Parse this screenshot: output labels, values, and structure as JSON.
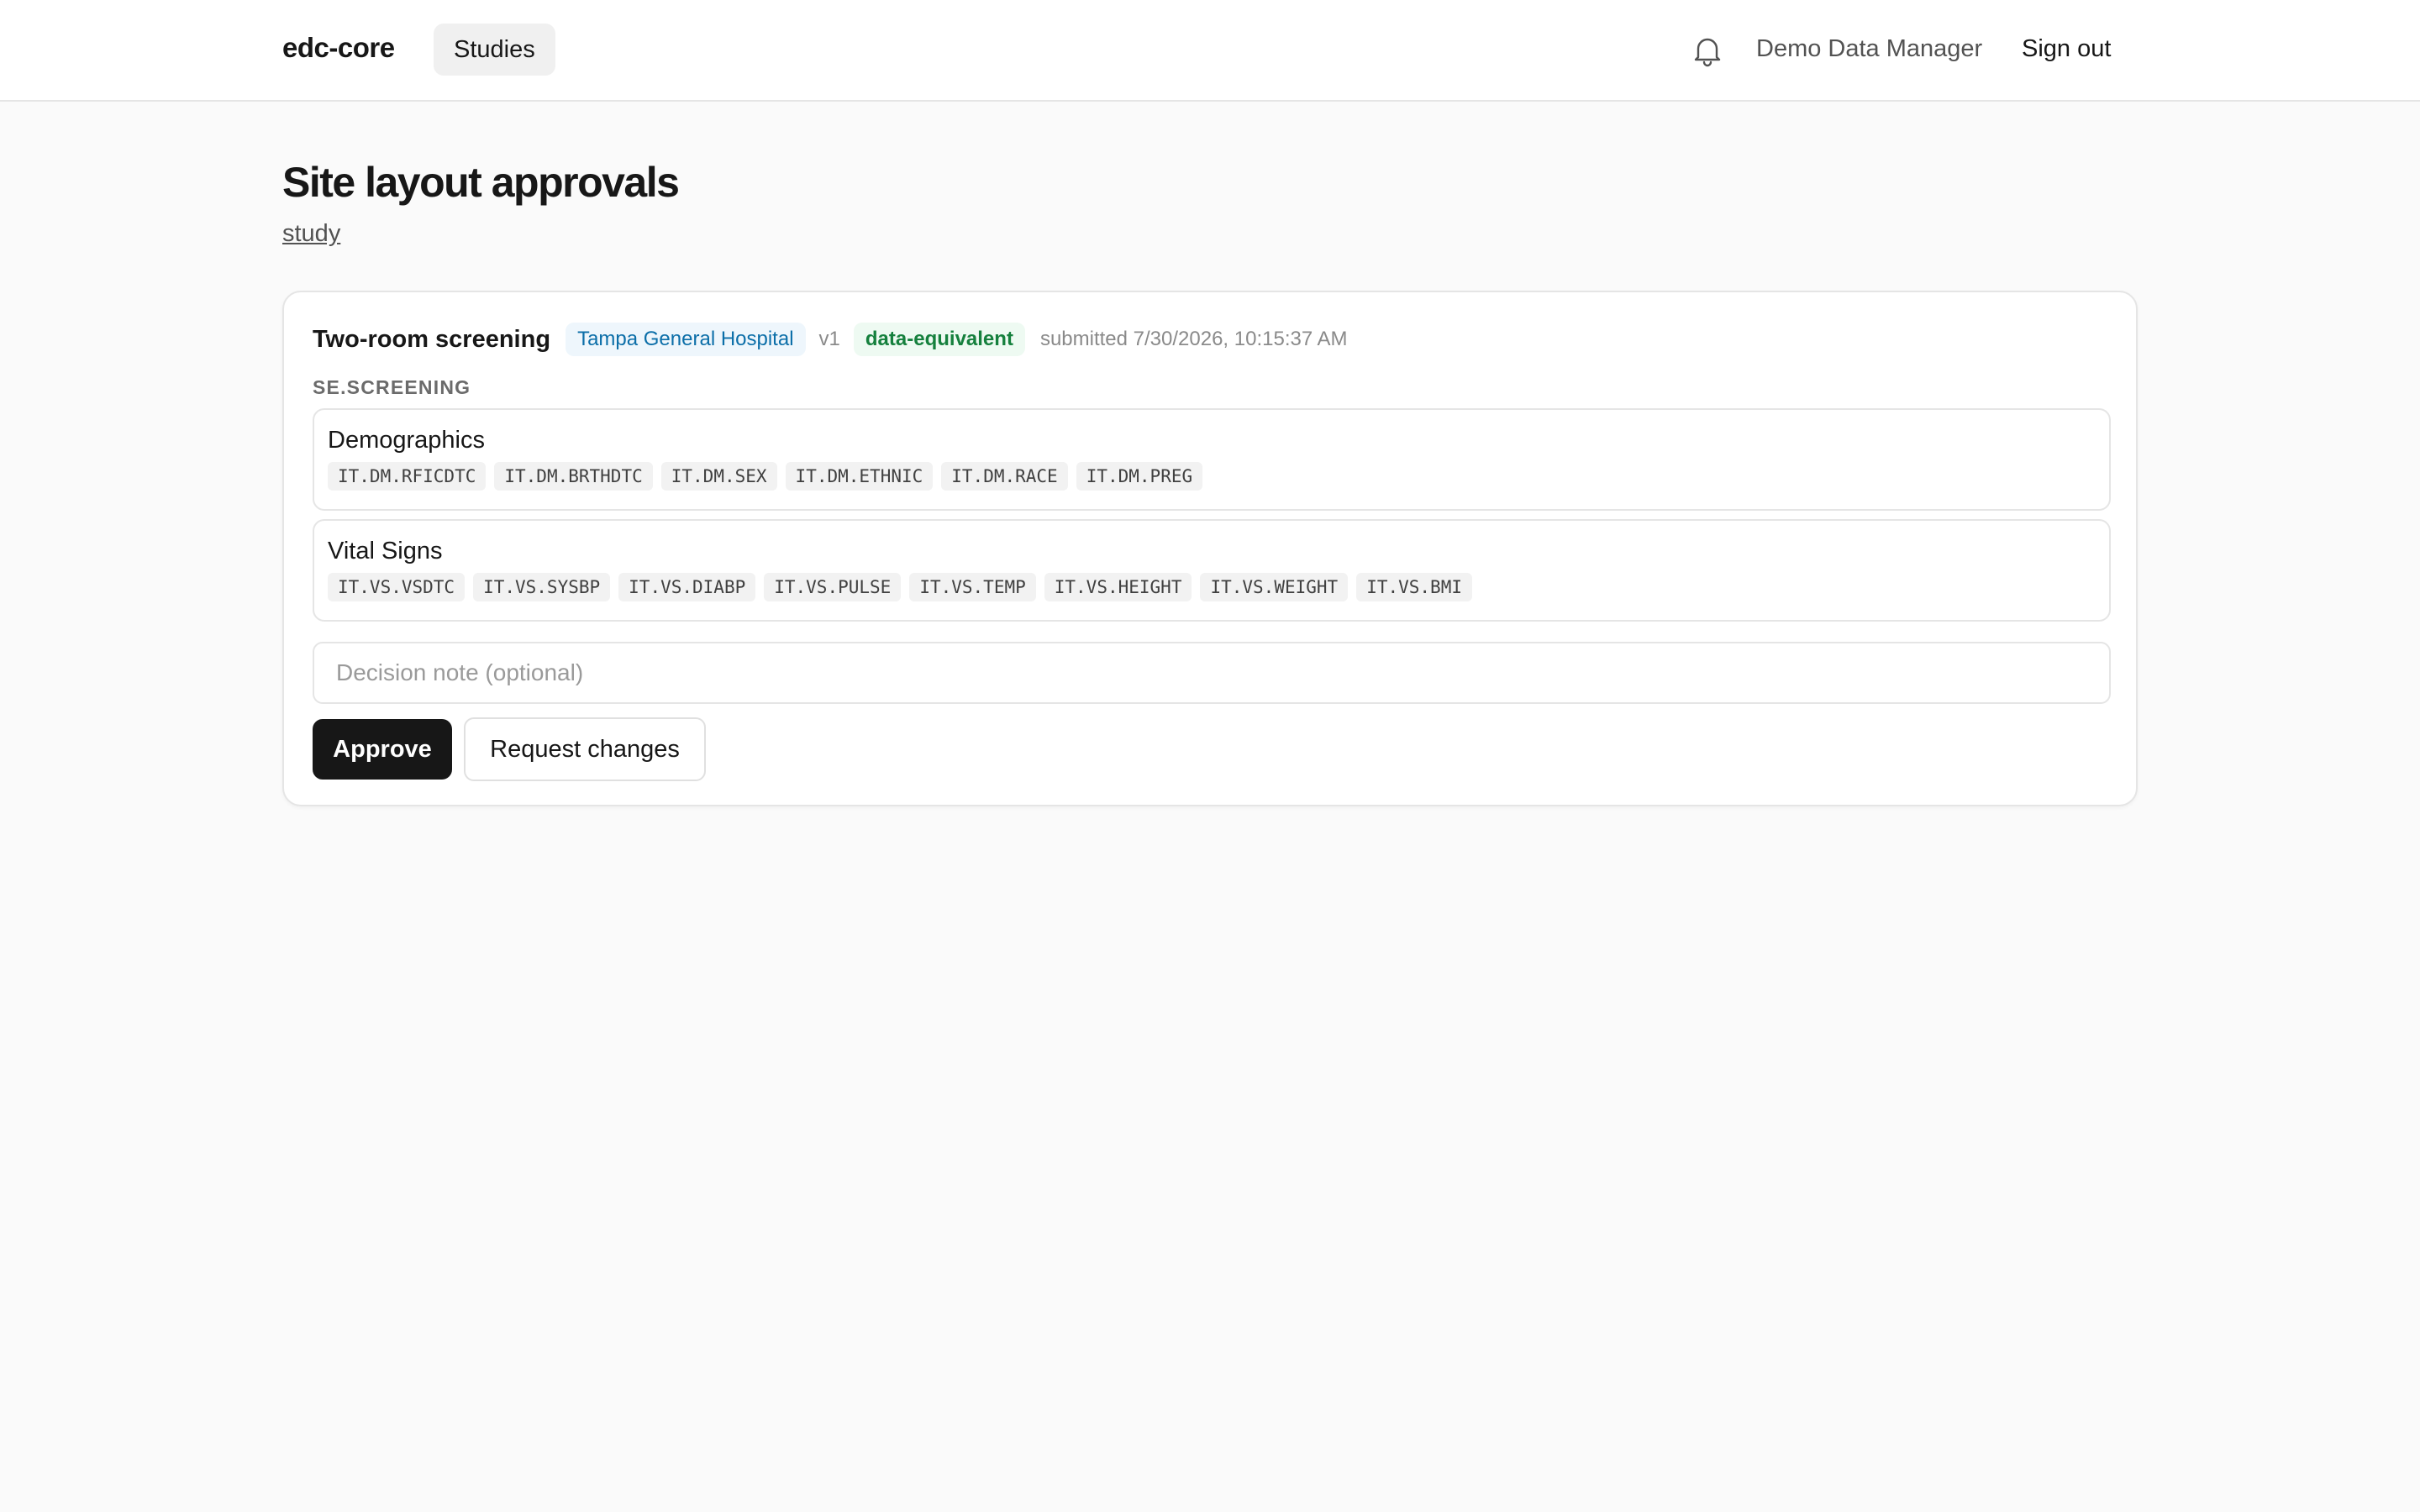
{
  "header": {
    "brand": "edc-core",
    "nav": {
      "studies_label": "Studies"
    },
    "bell_icon": "bell-icon",
    "user_name": "Demo Data Manager",
    "sign_out_label": "Sign out"
  },
  "page": {
    "title": "Site layout approvals",
    "study_link": "study"
  },
  "approval": {
    "layout_name": "Two-room screening",
    "site": "Tampa General Hospital",
    "version": "v1",
    "equivalence": "data-equivalent",
    "submitted": "submitted 7/30/2026, 10:15:37 AM",
    "event": "SE.SCREENING",
    "forms": [
      {
        "name": "Demographics",
        "items": [
          "IT.DM.RFICDTC",
          "IT.DM.BRTHDTC",
          "IT.DM.SEX",
          "IT.DM.ETHNIC",
          "IT.DM.RACE",
          "IT.DM.PREG"
        ]
      },
      {
        "name": "Vital Signs",
        "items": [
          "IT.VS.VSDTC",
          "IT.VS.SYSBP",
          "IT.VS.DIABP",
          "IT.VS.PULSE",
          "IT.VS.TEMP",
          "IT.VS.HEIGHT",
          "IT.VS.WEIGHT",
          "IT.VS.BMI"
        ]
      }
    ],
    "note_placeholder": "Decision note (optional)",
    "approve_label": "Approve",
    "request_changes_label": "Request changes"
  },
  "colors": {
    "site_badge_text": "#0b6ea8",
    "equiv_badge_text": "#15803d",
    "primary_button": "#171717"
  }
}
